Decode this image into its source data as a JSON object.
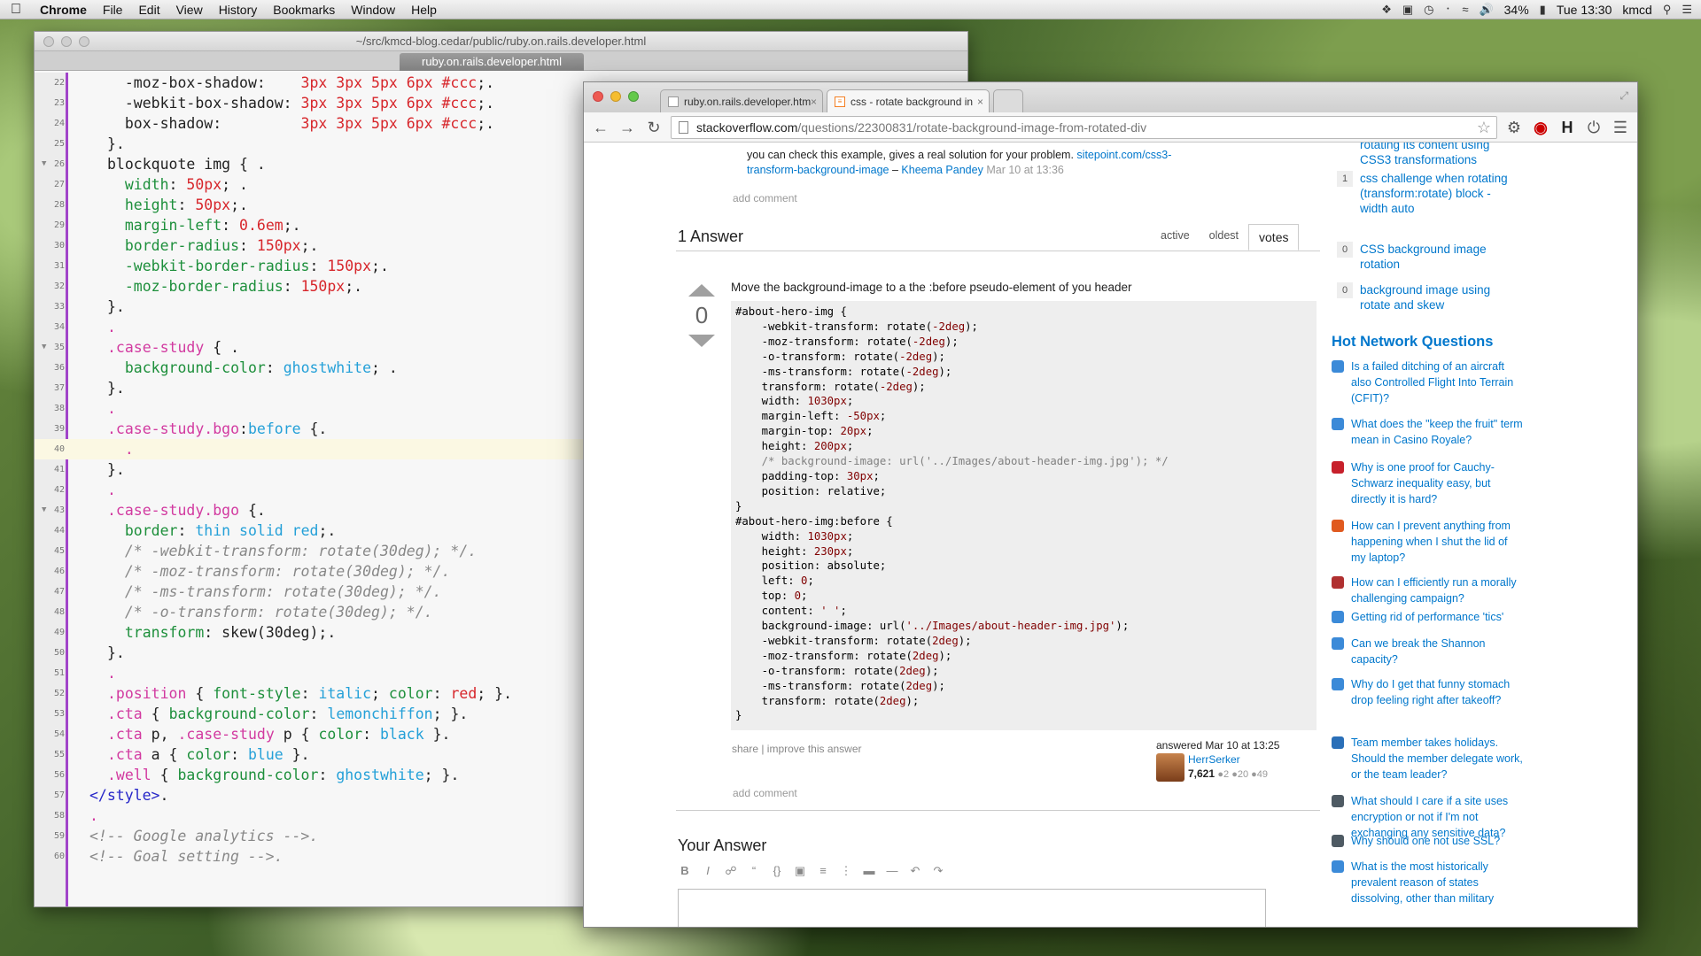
{
  "menubar": {
    "items": [
      "Chrome",
      "File",
      "Edit",
      "View",
      "History",
      "Bookmarks",
      "Window",
      "Help"
    ],
    "battery": "34%",
    "clock": "Tue 13:30",
    "user": "kmcd"
  },
  "editor": {
    "title": "~/src/kmcd-blog.cedar/public/ruby.on.rails.developer.html",
    "tab": "ruby.on.rails.developer.html"
  },
  "chrome": {
    "tabs": [
      "ruby.on.rails.developer.htm",
      "css - rotate background in"
    ],
    "url_host": "stackoverflow.com",
    "url_path": "/questions/22300831/rotate-background-image-from-rotated-div"
  },
  "so": {
    "comment_text": "you can check this example, gives a real solution for your problem.",
    "comment_link": "sitepoint.com/css3-transform-background-image",
    "comment_author": "Kheema Pandey",
    "comment_date": "Mar 10 at 13:36",
    "add_comment": "add comment",
    "answers_header": "1 Answer",
    "sort_tabs": [
      "active",
      "oldest",
      "votes"
    ],
    "vote_count": "0",
    "answer_text": "Move the background-image to a the :before pseudo-element of you header",
    "post_menu": "share | improve this answer",
    "answered": "answered Mar 10 at 13:25",
    "user_name": "HerrSerker",
    "user_rep": "7,621",
    "badges": "●2 ●20 ●49",
    "add_comment2": "add comment",
    "your_answer": "Your Answer"
  },
  "sidebar": {
    "related_top": "rotating its content using CSS3 transformations",
    "related": [
      {
        "count": "1",
        "title": "css challenge when rotating (transform:rotate) block - width auto"
      },
      {
        "count": "0",
        "title": "CSS background image rotation"
      },
      {
        "count": "0",
        "title": "background image using rotate and skew"
      }
    ],
    "hnq_title": "Hot Network Questions",
    "hnq": [
      {
        "icon": "aviation-icon",
        "color": "#3b8ad8",
        "title": "Is a failed ditching of an aircraft also Controlled Flight Into Terrain (CFIT)?"
      },
      {
        "icon": "movies-icon",
        "color": "#3b8ad8",
        "title": "What does the \"keep the fruit\" term mean in Casino Royale?"
      },
      {
        "icon": "math-icon",
        "color": "#c7202b",
        "title": "Why is one proof for Cauchy-Schwarz inequality easy, but directly it is hard?"
      },
      {
        "icon": "askubuntu-icon",
        "color": "#e05a1f",
        "title": "How can I prevent anything from happening when I shut the lid of my laptop?"
      },
      {
        "icon": "rpg-icon",
        "color": "#b03030",
        "title": "How can I efficiently run a morally challenging campaign?"
      },
      {
        "icon": "gamedev-icon",
        "color": "#3b8ad8",
        "title": "Getting rid of performance 'tics'"
      },
      {
        "icon": "dsp-icon",
        "color": "#3b8ad8",
        "title": "Can we break the Shannon capacity?"
      },
      {
        "icon": "physics-icon",
        "color": "#3b8ad8",
        "title": "Why do I get that funny stomach drop feeling right after takeoff?"
      },
      {
        "icon": "pm-icon",
        "color": "#2a6fb8",
        "title": "Team member takes holidays. Should the member delegate work, or the team leader?"
      },
      {
        "icon": "security-icon",
        "color": "#4e5a63",
        "title": "What should I care if a site uses encryption or not if I'm not exchanging any sensitive data?"
      },
      {
        "icon": "security-icon",
        "color": "#4e5a63",
        "title": "Why should one not use SSL?"
      },
      {
        "icon": "history-icon",
        "color": "#3b8ad8",
        "title": "What is the most historically prevalent reason of states dissolving, other than military"
      }
    ]
  }
}
